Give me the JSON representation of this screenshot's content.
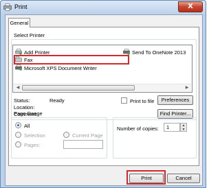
{
  "window": {
    "title": "Print",
    "close_glyph": "X"
  },
  "tabs": [
    {
      "label": "General"
    }
  ],
  "select_printer": {
    "title": "Select Printer",
    "printers": [
      {
        "name": "Add Printer",
        "icon": "add-printer-icon"
      },
      {
        "name": "Send To OneNote 2013",
        "icon": "printer-icon"
      },
      {
        "name": "Fax",
        "icon": "fax-icon"
      },
      {
        "name": "Microsoft XPS Document Writer",
        "icon": "printer-icon",
        "selected": true
      }
    ],
    "status_label": "Status:",
    "status_value": "Ready",
    "location_label": "Location:",
    "comment_label": "Comment:",
    "print_to_file_label": "Print to file",
    "preferences_label": "Preferences",
    "find_printer_label": "Find Printer..."
  },
  "page_range": {
    "title": "Page Range",
    "all_label": "All",
    "selection_label": "Selection",
    "current_page_label": "Current Page",
    "pages_label": "Pages:"
  },
  "copies": {
    "label": "Number of copies:",
    "value": "1"
  },
  "footer": {
    "print_label": "Print",
    "cancel_label": "Cancel"
  },
  "colors": {
    "highlight": "#d6272d",
    "title_bar": "#bcd2ea",
    "close_button": "#c7452f"
  }
}
